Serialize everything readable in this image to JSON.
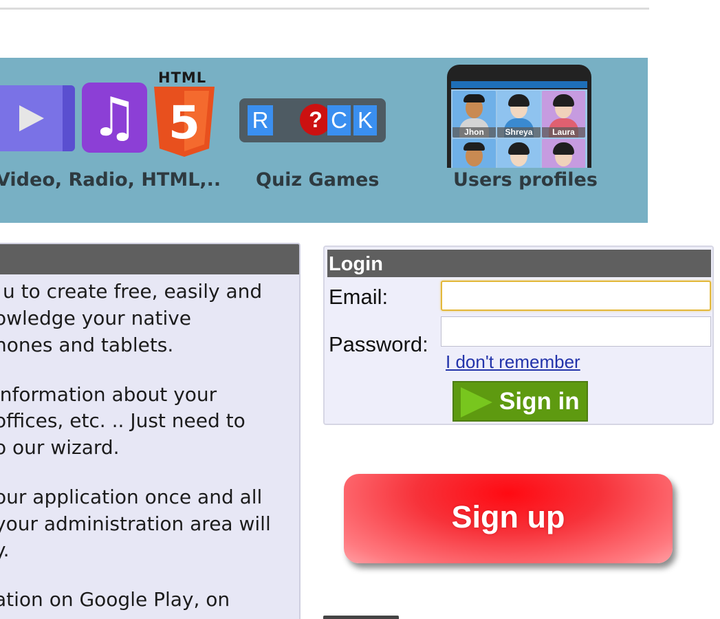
{
  "banner": {
    "features": [
      {
        "label": "Video, Radio, HTML,..",
        "icon": "media-icons"
      },
      {
        "label": "Quiz Games",
        "icon": "quiz-icon"
      },
      {
        "label": "Users profiles",
        "icon": "users-profiles-phone"
      }
    ],
    "html5_tag": "HTML",
    "html5_number": "5",
    "music_note": "♫",
    "quiz_letters": [
      "R",
      "?",
      "C",
      "K"
    ],
    "profiles": [
      "Jhon",
      "Shreya",
      "Laura"
    ],
    "colors": {
      "background": "#78b0c4",
      "label": "#2e3a40"
    }
  },
  "info_panel": {
    "lines": [
      "u to create free, easily and",
      "owledge your native",
      "hones and tablets.",
      " information about your",
      " offices, etc. .. Just need to",
      "o our wizard.",
      "our application once and all",
      " your administration area will",
      "y.",
      "ation on Google Play, on"
    ]
  },
  "login": {
    "title": "Login",
    "email_label": "Email:",
    "password_label": "Password:",
    "email_value": "",
    "password_value": "",
    "forgot_label": "I don't remember",
    "signin_label": "Sign in",
    "colors": {
      "signin": "#5e9a10",
      "link": "#2233aa"
    }
  },
  "signup": {
    "label": "Sign up",
    "color": "#f7323a"
  }
}
